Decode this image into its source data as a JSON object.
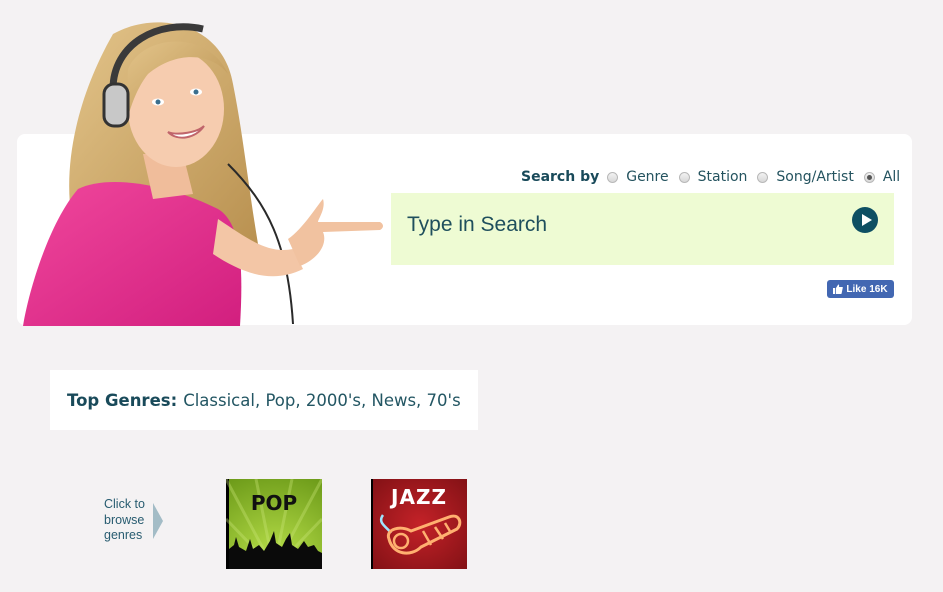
{
  "search": {
    "label": "Search by",
    "options": [
      {
        "label": "Genre",
        "checked": false
      },
      {
        "label": "Station",
        "checked": false
      },
      {
        "label": "Song/Artist",
        "checked": false
      },
      {
        "label": "All",
        "checked": true
      }
    ],
    "placeholder": "Type in Search",
    "value": ""
  },
  "facebook": {
    "like_label": "Like 16K",
    "color": "#4267b2"
  },
  "top_genres": {
    "label": "Top Genres:",
    "items": [
      "Classical",
      "Pop",
      "2000's",
      "News",
      "70's"
    ],
    "text": "Classical, Pop, 2000's, News, 70's"
  },
  "browse": {
    "hint": "Click to browse genres",
    "tiles": [
      {
        "label": "POP",
        "genre": "Pop"
      },
      {
        "label": "JAZZ",
        "genre": "Jazz"
      }
    ]
  },
  "colors": {
    "page_bg": "#f4f2f3",
    "search_bg": "#eefbd3",
    "accent": "#0e4f63",
    "text": "#1f4f5d"
  }
}
